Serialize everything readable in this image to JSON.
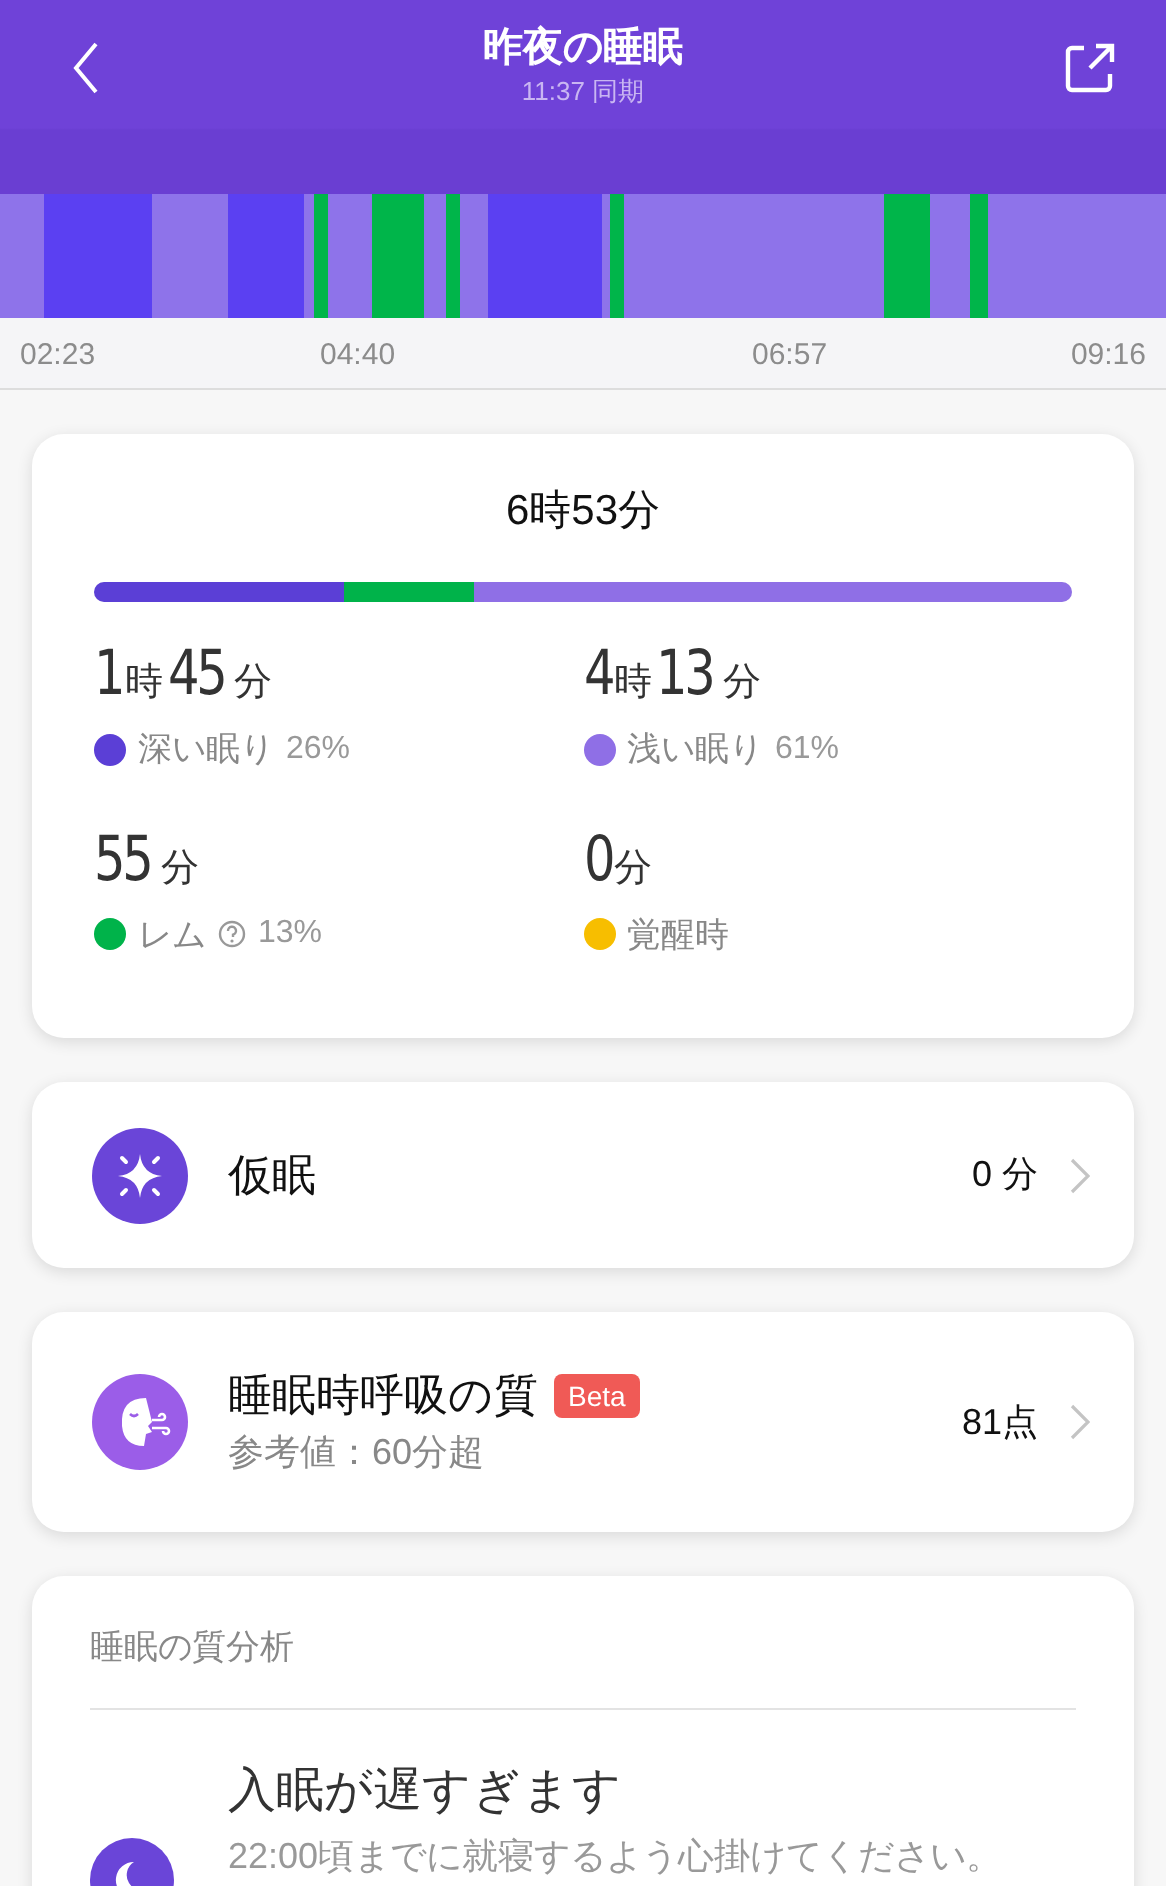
{
  "header": {
    "title": "昨夜の睡眠",
    "subtitle": "11:37 同期"
  },
  "timeline": {
    "ticks": [
      "02:23",
      "04:40",
      "06:57",
      "09:16"
    ]
  },
  "summary": {
    "total": "6時53分",
    "stages": [
      {
        "value_parts": [
          "1",
          "時",
          "45",
          "分"
        ],
        "label": "深い眠り",
        "percent": "26%",
        "color": "#5b3fd6",
        "help": false
      },
      {
        "value_parts": [
          "4",
          "時",
          "13",
          "分"
        ],
        "label": "浅い眠り",
        "percent": "61%",
        "color": "#8f6fe6",
        "help": false
      },
      {
        "value_parts": [
          "55",
          "分"
        ],
        "label": "レム",
        "percent": "13%",
        "color": "#00b34a",
        "help": true
      },
      {
        "value_parts": [
          "0",
          "分"
        ],
        "label": "覚醒時",
        "color": "#f7be00",
        "help": false
      }
    ]
  },
  "rows": [
    {
      "kind": "nap",
      "title": "仮眠",
      "value": "0 分"
    },
    {
      "kind": "breathing",
      "title": "睡眠時呼吸の質",
      "badge": "Beta",
      "subtitle": "参考値：60分超",
      "value": "81点"
    }
  ],
  "analysis": {
    "title": "睡眠の質分析",
    "items": [
      {
        "title": "入眠が遅すぎます",
        "text": "22:00頃までに就寝するよう心掛けてください。"
      }
    ]
  }
}
